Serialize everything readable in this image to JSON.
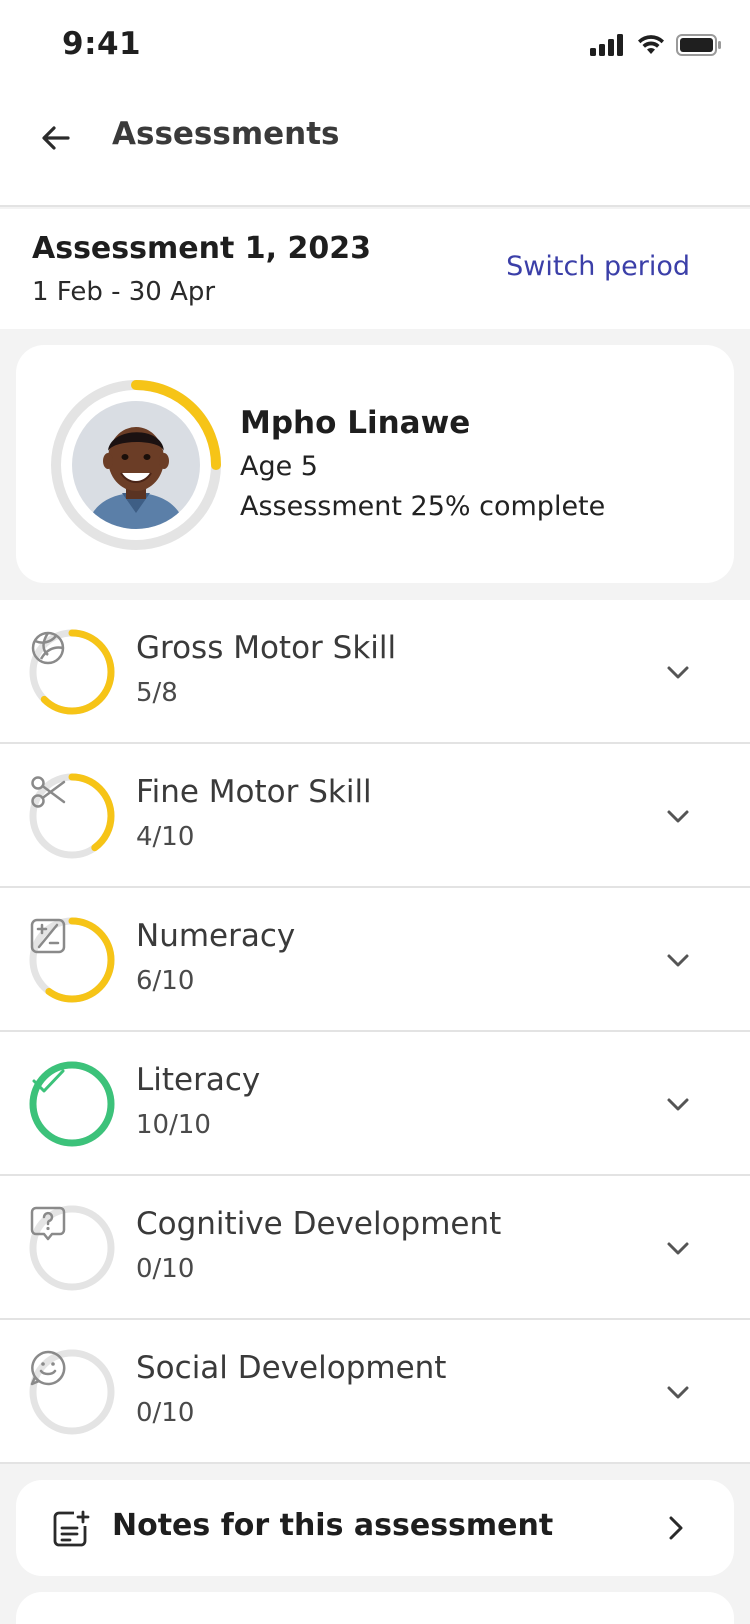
{
  "status_bar": {
    "time": "9:41",
    "icons": [
      "signal-icon",
      "wifi-icon",
      "battery-icon"
    ]
  },
  "header": {
    "title": "Assessments",
    "back_icon": "arrow-left-icon"
  },
  "period": {
    "title": "Assessment 1, 2023",
    "range": "1 Feb - 30 Apr",
    "switch_label": "Switch period"
  },
  "child": {
    "name": "Mpho Linawe",
    "age": "Age 5",
    "progress_text": "Assessment 25% complete",
    "progress_fraction": 0.25
  },
  "colors": {
    "accent_yellow": "#f6c417",
    "complete_green": "#3cc27a",
    "track_gray": "#e4e4e4",
    "link_blue": "#3b3fa8"
  },
  "skills": [
    {
      "name": "Gross Motor Skill",
      "score": "5/8",
      "fraction": 0.625,
      "icon": "volleyball-icon",
      "complete": false
    },
    {
      "name": "Fine Motor Skill",
      "score": "4/10",
      "fraction": 0.4,
      "icon": "scissors-icon",
      "complete": false
    },
    {
      "name": "Numeracy",
      "score": "6/10",
      "fraction": 0.6,
      "icon": "calculator-icon",
      "complete": false
    },
    {
      "name": "Literacy",
      "score": "10/10",
      "fraction": 1.0,
      "icon": "check-icon",
      "complete": true
    },
    {
      "name": "Cognitive Development",
      "score": "0/10",
      "fraction": 0.0,
      "icon": "question-bubble-icon",
      "complete": false
    },
    {
      "name": "Social Development",
      "score": "0/10",
      "fraction": 0.0,
      "icon": "smiley-bubble-icon",
      "complete": false
    }
  ],
  "notes": {
    "label": "Notes for this assessment",
    "icon": "note-add-icon"
  }
}
